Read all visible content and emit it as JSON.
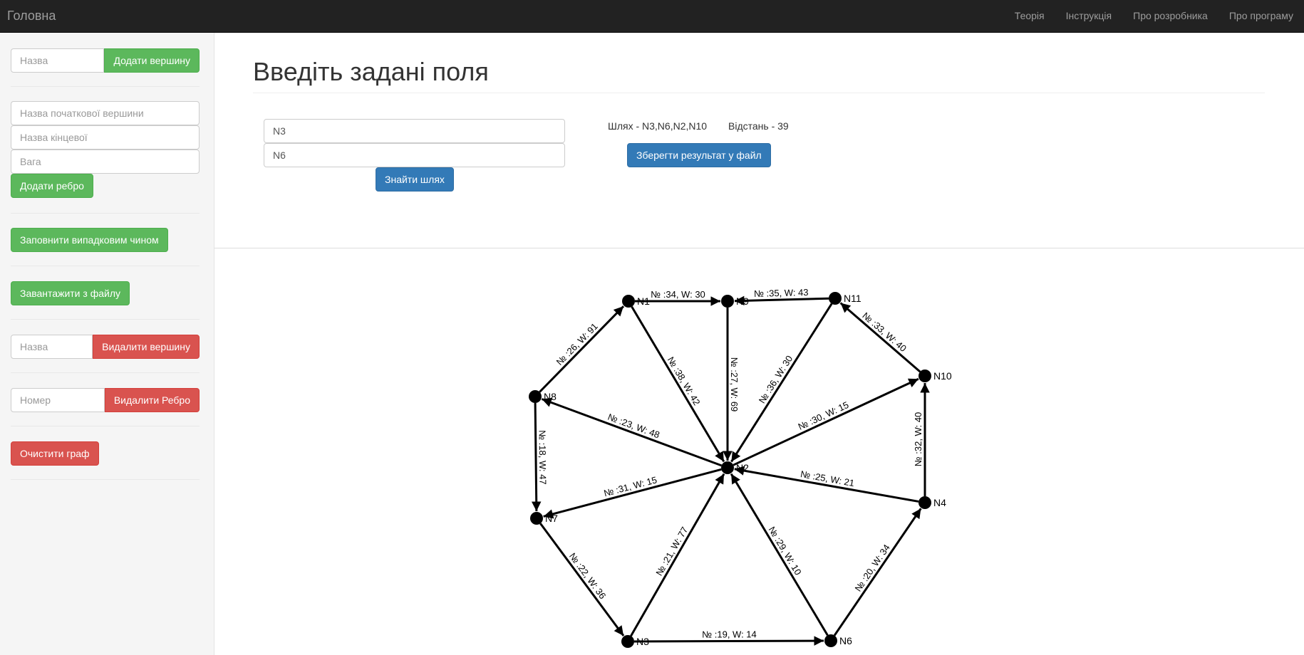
{
  "navbar": {
    "brand": "Головна",
    "links": [
      "Теорія",
      "Інструкція",
      "Про розробника",
      "Про програму"
    ]
  },
  "sidebar": {
    "add_vertex": {
      "placeholder": "Назва",
      "button": "Додати вершину"
    },
    "add_edge": {
      "start_placeholder": "Назва початкової вершини",
      "end_placeholder": "Назва кінцевої",
      "weight_placeholder": "Вага",
      "button": "Додати ребро"
    },
    "random_button": "Заповнити випадковим чином",
    "load_button": "Завантажити з файлу",
    "delete_vertex": {
      "placeholder": "Назва",
      "button": "Видалити вершину"
    },
    "delete_edge": {
      "placeholder": "Номер",
      "button": "Видалити Ребро"
    },
    "clear_button": "Очистити граф"
  },
  "main": {
    "title": "Введіть задані поля",
    "start_value": "N3",
    "end_value": "N6",
    "find_button": "Знайти шлях",
    "path_text": "Шлях - N3,N6,N2,N10",
    "distance_text": "Відстань - 39",
    "save_button": "Зберегти результат у файл"
  },
  "graph": {
    "nodes": [
      "N1",
      "N9",
      "N11",
      "N10",
      "N8",
      "N2",
      "N7",
      "N4",
      "N3",
      "N6"
    ],
    "edges": [
      {
        "from": "N1",
        "to": "N9",
        "label": "№ :34, W: 30"
      },
      {
        "from": "N11",
        "to": "N9",
        "label": "№ :35, W: 43"
      },
      {
        "from": "N8",
        "to": "N1",
        "label": "№ :26, W: 91"
      },
      {
        "from": "N10",
        "to": "N11",
        "label": "№ :33, W: 40"
      },
      {
        "from": "N1",
        "to": "N2",
        "label": "№ :38, W: 42"
      },
      {
        "from": "N9",
        "to": "N2",
        "label": "№ :27, W: 69"
      },
      {
        "from": "N11",
        "to": "N2",
        "label": "№ :36, W: 30"
      },
      {
        "from": "N2",
        "to": "N10",
        "label": "№ :30, W: 15"
      },
      {
        "from": "N4",
        "to": "N10",
        "label": "№ :32, W: 40"
      },
      {
        "from": "N2",
        "to": "N8",
        "label": "№ :23, W: 48"
      },
      {
        "from": "N8",
        "to": "N7",
        "label": "№ :18, W: 47"
      },
      {
        "from": "N2",
        "to": "N7",
        "label": "№ :31, W: 15"
      },
      {
        "from": "N4",
        "to": "N2",
        "label": "№ :25, W: 21"
      },
      {
        "from": "N7",
        "to": "N3",
        "label": "№ :22, W: 36"
      },
      {
        "from": "N3",
        "to": "N2",
        "label": "№ :21, W: 77"
      },
      {
        "from": "N6",
        "to": "N2",
        "label": "№ :29, W: 10"
      },
      {
        "from": "N6",
        "to": "N4",
        "label": "№ :20, W: 34"
      },
      {
        "from": "N3",
        "to": "N6",
        "label": "№ :19, W: 14"
      }
    ]
  }
}
